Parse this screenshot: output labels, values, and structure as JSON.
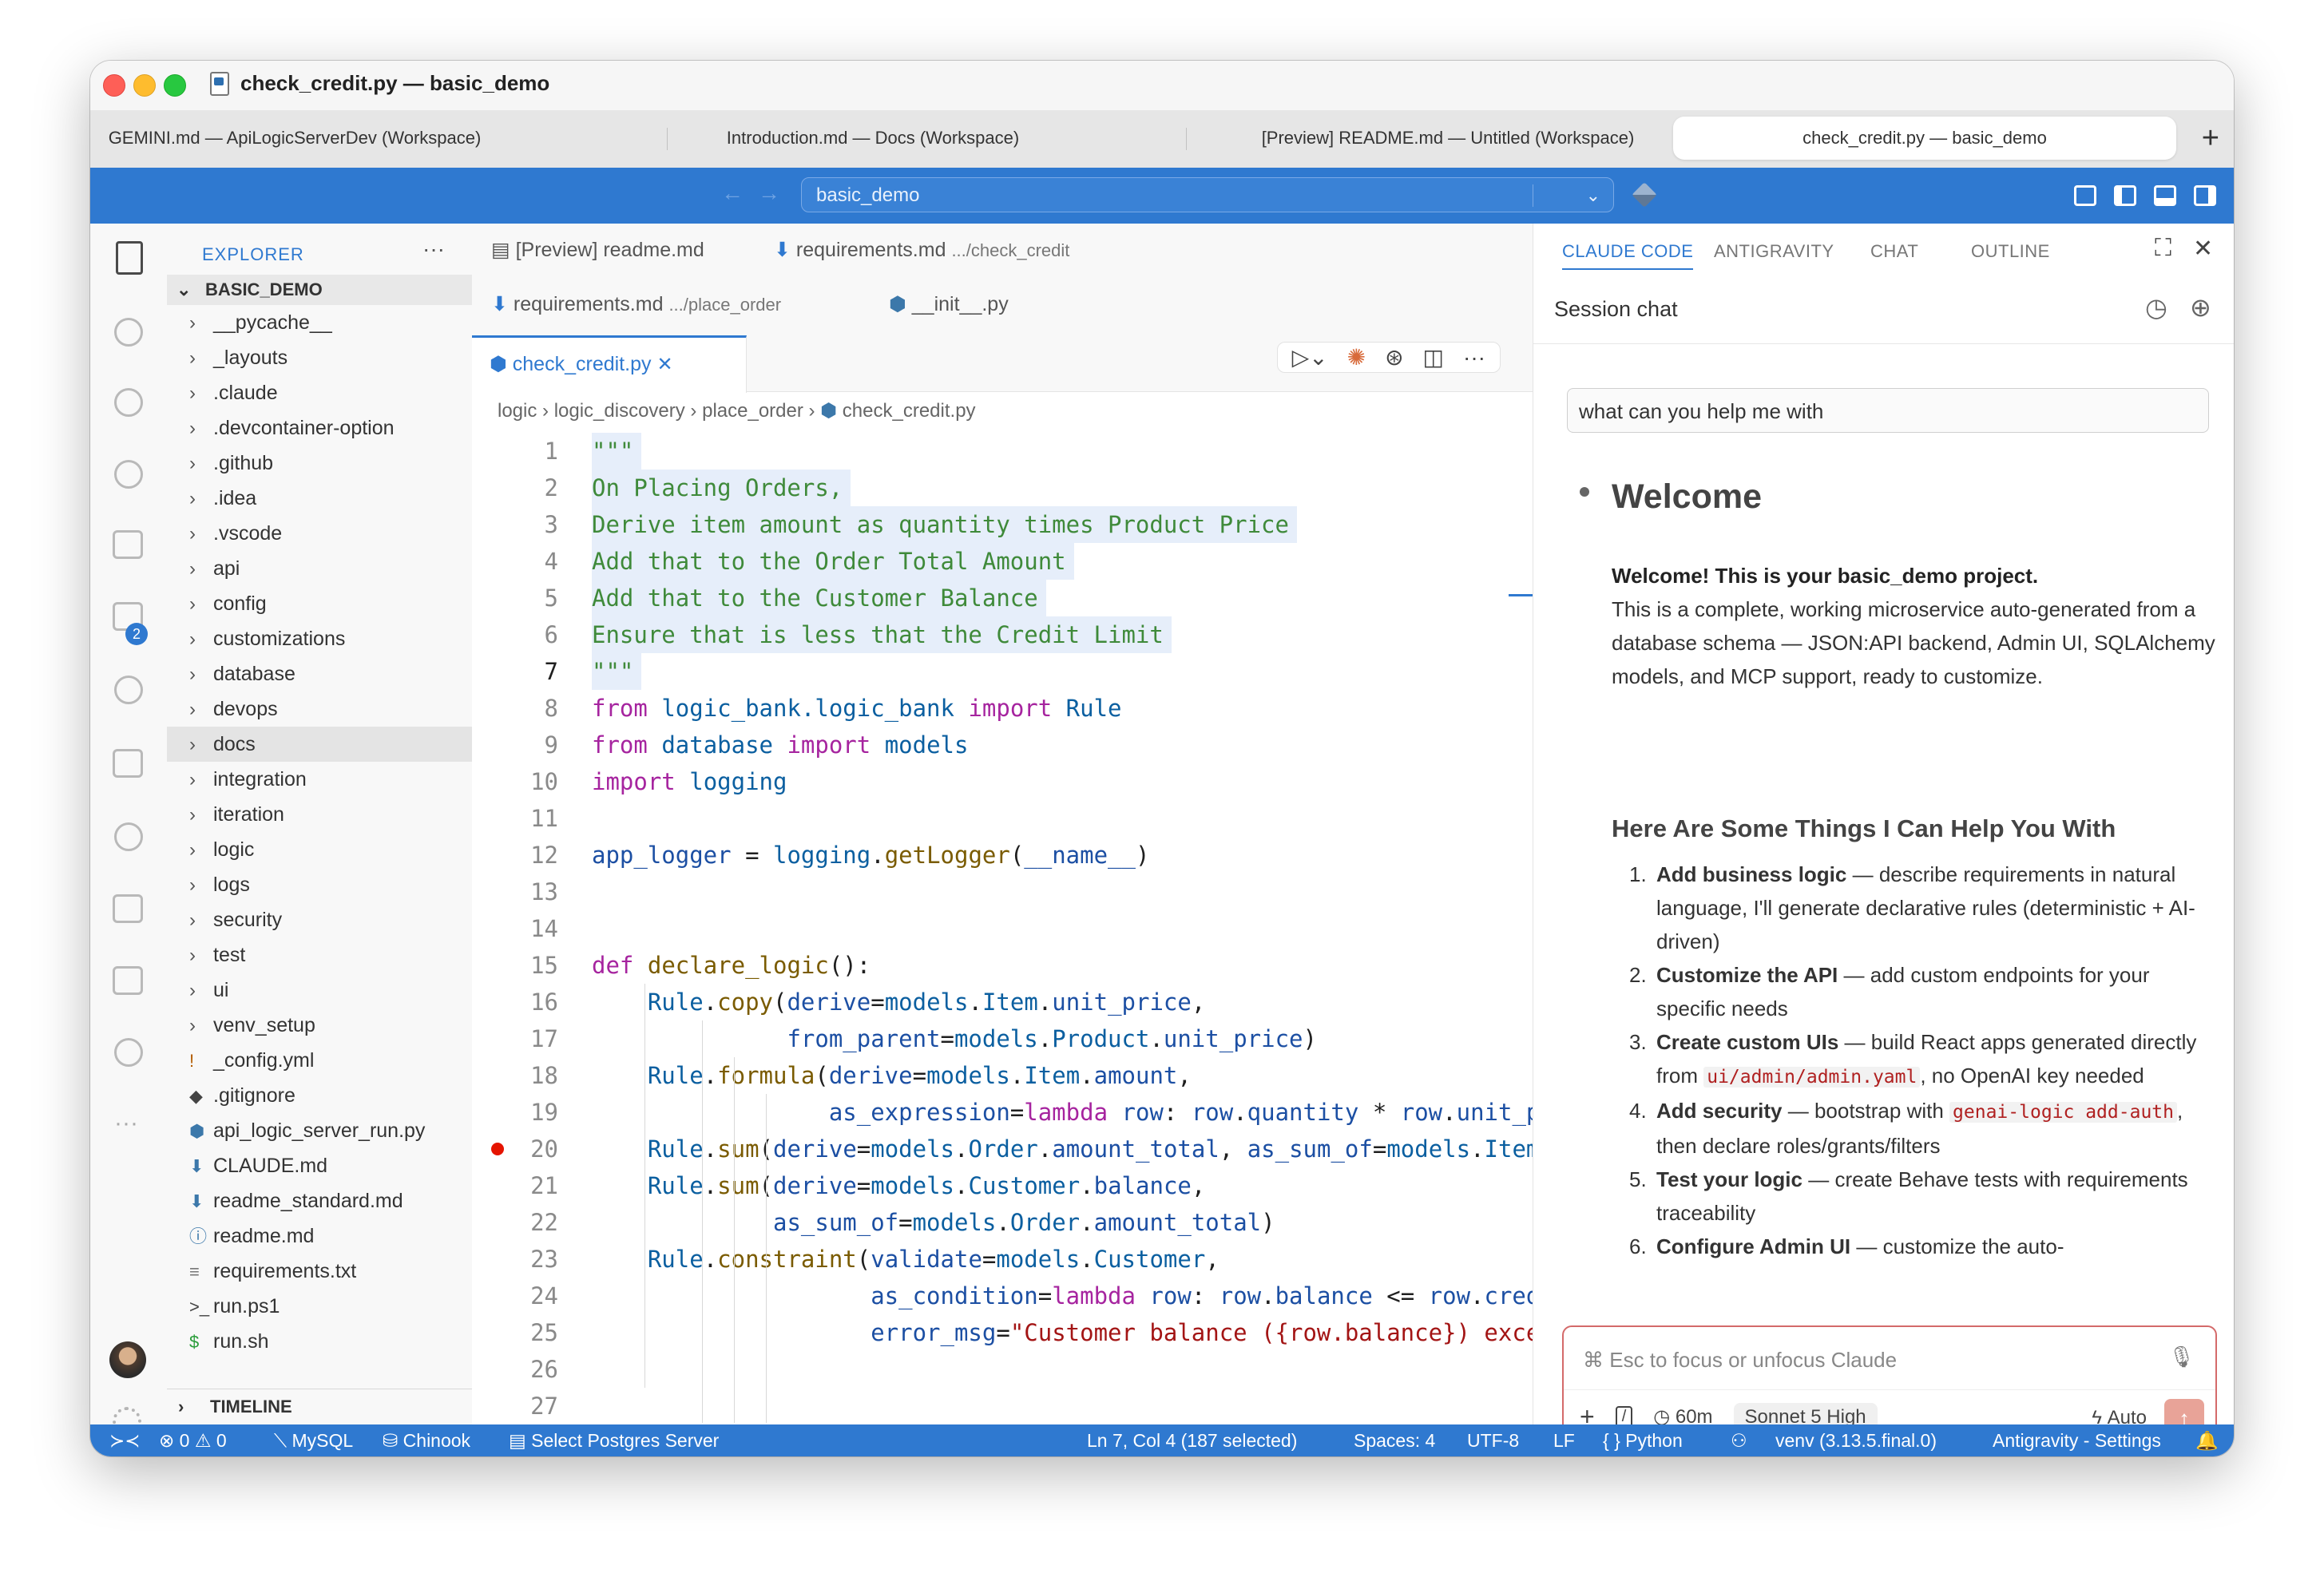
{
  "window": {
    "title": "check_credit.py — basic_demo",
    "tabs": [
      {
        "label": "GEMINI.md — ApiLogicServerDev (Workspace)"
      },
      {
        "label": "Introduction.md — Docs (Workspace)"
      },
      {
        "label": "[Preview] README.md — Untitled (Workspace)"
      },
      {
        "label": "check_credit.py — basic_demo"
      }
    ],
    "new_tab_label": "+"
  },
  "command_center": {
    "value": "basic_demo"
  },
  "activity_badge": "2",
  "explorer": {
    "header": "EXPLORER",
    "project": "BASIC_DEMO",
    "items": [
      {
        "label": "__pycache__",
        "type": "folder"
      },
      {
        "label": "_layouts",
        "type": "folder"
      },
      {
        "label": ".claude",
        "type": "folder"
      },
      {
        "label": ".devcontainer-option",
        "type": "folder"
      },
      {
        "label": ".github",
        "type": "folder"
      },
      {
        "label": ".idea",
        "type": "folder"
      },
      {
        "label": ".vscode",
        "type": "folder"
      },
      {
        "label": "api",
        "type": "folder"
      },
      {
        "label": "config",
        "type": "folder"
      },
      {
        "label": "customizations",
        "type": "folder"
      },
      {
        "label": "database",
        "type": "folder"
      },
      {
        "label": "devops",
        "type": "folder"
      },
      {
        "label": "docs",
        "type": "folder",
        "selected": true
      },
      {
        "label": "integration",
        "type": "folder"
      },
      {
        "label": "iteration",
        "type": "folder"
      },
      {
        "label": "logic",
        "type": "folder"
      },
      {
        "label": "logs",
        "type": "folder"
      },
      {
        "label": "security",
        "type": "folder"
      },
      {
        "label": "test",
        "type": "folder"
      },
      {
        "label": "ui",
        "type": "folder"
      },
      {
        "label": "venv_setup",
        "type": "folder"
      },
      {
        "label": "_config.yml",
        "type": "file",
        "icon": "!"
      },
      {
        "label": ".gitignore",
        "type": "file",
        "icon": "◆"
      },
      {
        "label": "api_logic_server_run.py",
        "type": "file",
        "icon": "py"
      },
      {
        "label": "CLAUDE.md",
        "type": "file",
        "icon": "md"
      },
      {
        "label": "readme_standard.md",
        "type": "file",
        "icon": "md"
      },
      {
        "label": "readme.md",
        "type": "file",
        "icon": "ⓘ"
      },
      {
        "label": "requirements.txt",
        "type": "file",
        "icon": "≡"
      },
      {
        "label": "run.ps1",
        "type": "file",
        "icon": ">_"
      },
      {
        "label": "run.sh",
        "type": "file",
        "icon": "$"
      }
    ],
    "timeline": "TIMELINE"
  },
  "editor": {
    "tabs_row1": [
      {
        "label": "[Preview] readme.md",
        "sub": ""
      },
      {
        "label": "requirements.md",
        "sub": ".../check_credit"
      }
    ],
    "tabs_row2": [
      {
        "label": "requirements.md",
        "sub": ".../place_order"
      },
      {
        "label": "__init__.py",
        "sub": ""
      }
    ],
    "active_tab": "check_credit.py",
    "breadcrumb": [
      "logic",
      "logic_discovery",
      "place_order",
      "check_credit.py"
    ],
    "current_line": 7,
    "breakpoint_line": 20
  },
  "chat": {
    "tabs": [
      "CLAUDE CODE",
      "ANTIGRAVITY",
      "CHAT",
      "OUTLINE"
    ],
    "session_title": "Session chat",
    "user_message": "what can you help me with",
    "welcome_heading": "Welcome",
    "intro_bold": "Welcome! This is your basic_demo project.",
    "intro_text": "This is a complete, working microservice auto-generated from a database schema — JSON:API backend, Admin UI, SQLAlchemy models, and MCP support, ready to customize.",
    "help_heading": "Here Are Some Things I Can Help You With",
    "items": [
      {
        "num": "1.",
        "bold": "Add business logic",
        "text": " — describe requirements in natural language, I'll generate declarative rules (deterministic + AI-driven)"
      },
      {
        "num": "2.",
        "bold": "Customize the API",
        "text": " — add custom endpoints for your specific needs"
      },
      {
        "num": "3.",
        "bold": "Create custom UIs",
        "text_before": " — build React apps generated directly from ",
        "code": "ui/admin/admin.yaml",
        "text_after": ", no OpenAI key needed"
      },
      {
        "num": "4.",
        "bold": "Add security",
        "text_before": " — bootstrap with ",
        "code": "genai-logic add-auth",
        "text_after": ", then declare roles/grants/filters"
      },
      {
        "num": "5.",
        "bold": "Test your logic",
        "text": " — create Behave tests with requirements traceability"
      },
      {
        "num": "6.",
        "bold": "Configure Admin UI",
        "text": " — customize the auto-"
      }
    ],
    "input_placeholder": "⌘ Esc to focus or unfocus Claude",
    "time_label": "60m",
    "model_label": "Sonnet 5 High",
    "mode_label": "Auto"
  },
  "status_bar": {
    "problems": "⊗ 0 ⚠ 0",
    "mysql": "MySQL",
    "chinook": "Chinook",
    "postgres": "Select Postgres Server",
    "position": "Ln 7, Col 4 (187 selected)",
    "spaces": "Spaces: 4",
    "encoding": "UTF-8",
    "eol": "LF",
    "language": "Python",
    "venv": "venv (3.13.5.final.0)",
    "settings": "Antigravity - Settings"
  }
}
